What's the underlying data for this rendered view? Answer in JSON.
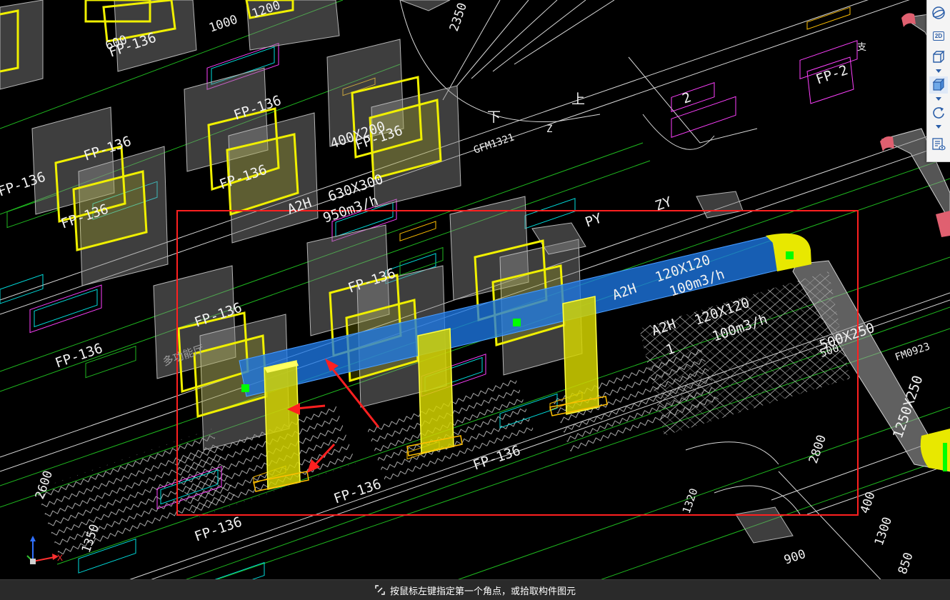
{
  "canvas": {
    "background": "#000000",
    "selection_box_color": "#ff2020",
    "duct_blue": "#1e78e6",
    "duct_yellow": "#f0f000",
    "grip_green": "#00ff00",
    "labels": {
      "fp136_a": "FP-136",
      "fp136_b": "FP-136",
      "fp136_c": "FP-136",
      "fp136_d": "FP-136",
      "fp136_e": "FP-136",
      "fp136_f": "FP-136",
      "fp136_g": "FP-136",
      "fp136_h": "FP-136",
      "fp136_i": "FP-136",
      "fp136_j": "FP-136",
      "fp136_k": "FP-136",
      "fp136_l": "FP-136",
      "fp136_m": "FP-136",
      "a2h_1": "A2H",
      "a2h_2": "A2H",
      "a2h_3": "A2H",
      "size_630x300": "630X300",
      "flow_950": "950m3/h",
      "size_400x200": "400X200",
      "size_120x120_a": "120X120",
      "flow_100_a": "100m3/h",
      "size_120x120_b": "120X120",
      "flow_100_b": "100m3/h",
      "size_500x250": "500X250",
      "size_1250x250": "1250X250",
      "py": "PY",
      "zy": "ZY",
      "gfm1321": "GFM1321",
      "num_2": "2",
      "num_1": "1",
      "dim_1000": "1000",
      "dim_1200": "1200",
      "dim_2350": "2350",
      "dim_600": "600",
      "dim_2600": "2600",
      "dim_1350": "1350",
      "dim_2800": "2800",
      "dim_1300": "1300",
      "dim_400": "400",
      "dim_900": "900",
      "dim_850": "850",
      "dim_1320": "1320",
      "dim_500": "500",
      "fm0923": "FM0923",
      "fp2": "FP-2",
      "zhi": "支",
      "xia": "下",
      "shang": "上",
      "z": "Z",
      "duo": "多功能厅"
    }
  },
  "toolbar": {
    "buttons": [
      {
        "name": "orbit-view",
        "icon": "orbit-icon"
      },
      {
        "name": "view-2d",
        "icon": "2d-icon",
        "label": "2D"
      },
      {
        "name": "view-3d-wire",
        "icon": "cube-outline-icon"
      },
      {
        "name": "view-3d-solid",
        "icon": "cube-solid-icon"
      },
      {
        "name": "rotate",
        "icon": "rotate-icon"
      },
      {
        "name": "properties",
        "icon": "properties-eye-icon"
      }
    ]
  },
  "axis": {
    "x_label": "X",
    "x_color": "#ff3030",
    "y_color": "#30c030",
    "z_color": "#3070ff"
  },
  "status": {
    "icon": "box-select-icon",
    "message": "按鼠标左键指定第一个角点，或拾取构件图元"
  }
}
